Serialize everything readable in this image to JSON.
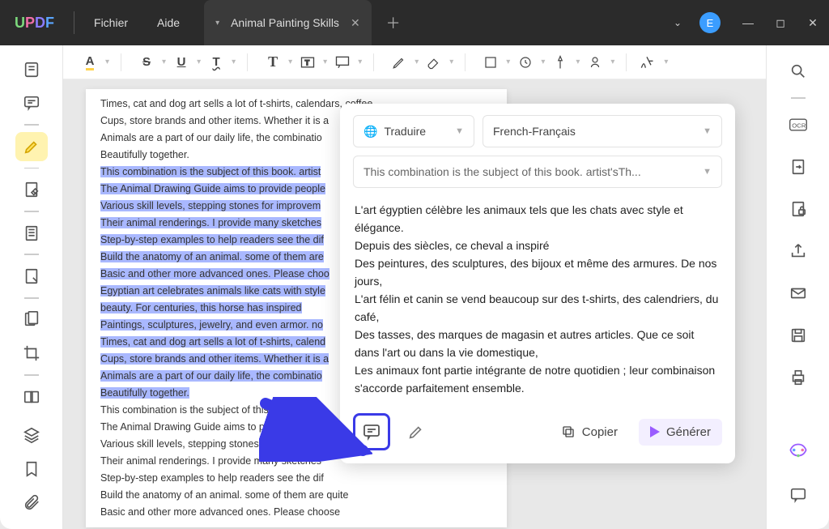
{
  "titlebar": {
    "menu_file": "Fichier",
    "menu_help": "Aide",
    "tab_title": "Animal Painting Skills",
    "avatar_letter": "E"
  },
  "toolbar": {
    "highlight": "A",
    "strike": "S",
    "underline": "U",
    "text_t": "T"
  },
  "doc": {
    "lines_top": [
      "Times, cat and dog art sells a lot of t-shirts, calendars, coffee",
      "Cups, store brands and other items. Whether it is a",
      "Animals are a part of our daily life, the combinatio",
      "Beautifully together."
    ],
    "lines_hl": [
      "This combination is the subject of this book. artist",
      "The Animal Drawing Guide aims to provide people",
      "Various skill levels, stepping stones for improvem",
      "Their animal renderings. I provide many sketches",
      "Step-by-step examples to help readers see the dif",
      "Build the anatomy of an animal. some of them are",
      "Basic and other more advanced ones. Please choo",
      "Egyptian art celebrates animals like cats with style",
      "beauty. For centuries, this horse has inspired",
      "Paintings, sculptures, jewelry, and even armor. no",
      "Times, cat and dog art sells a lot of t-shirts, calend",
      "Cups, store brands and other items. Whether it is a",
      "Animals are a part of our daily life, the combinatio",
      "Beautifully together."
    ],
    "lines_bottom": [
      "This combination is the subject of this book. artist",
      "The Animal Drawing Guide aims to provide people",
      "Various skill levels, stepping stones for improvem",
      "Their animal renderings. I provide many sketches",
      "Step-by-step examples to help readers see the dif",
      "Build the anatomy of an animal. some of them are quite",
      "Basic and other more advanced ones. Please choose"
    ]
  },
  "panel": {
    "translate_label": "Traduire",
    "lang": "French-Français",
    "source_preview": "This combination is the subject of this book. artist'sTh...",
    "translation": "L'art égyptien célèbre les animaux tels que les chats avec style et élégance.\nDepuis des siècles, ce cheval a inspiré\nDes peintures, des sculptures, des bijoux et même des armures. De nos jours,\nL'art félin et canin se vend beaucoup sur des t-shirts, des calendriers, du café,\nDes tasses, des marques de magasin et autres articles. Que ce soit dans l'art ou dans la vie domestique,\nLes animaux font partie intégrante de notre quotidien ; leur combinaison s'accorde parfaitement ensemble.",
    "copy": "Copier",
    "generate": "Générer"
  }
}
